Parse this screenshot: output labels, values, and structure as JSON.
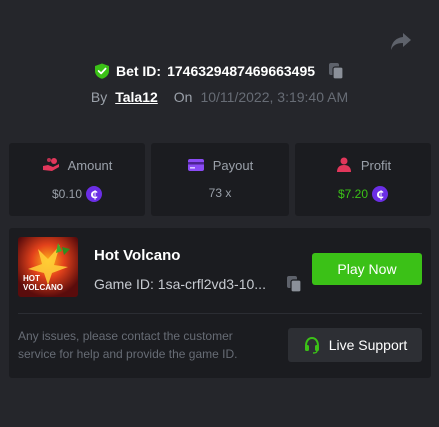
{
  "header": {
    "bet_label": "Bet ID:",
    "bet_id": "1746329487469663495",
    "by_label": "By",
    "username": "Tala12",
    "on_label": "On",
    "datetime": "10/11/2022, 3:19:40 AM"
  },
  "stats": {
    "amount": {
      "label": "Amount",
      "value": "$0.10",
      "icon": "coins-hand-icon"
    },
    "payout": {
      "label": "Payout",
      "value": "73 x",
      "icon": "payout-card-icon"
    },
    "profit": {
      "label": "Profit",
      "value": "$7.20",
      "icon": "profit-person-icon"
    }
  },
  "coin_symbol": "₵",
  "game": {
    "title": "Hot Volcano",
    "id_label": "Game ID:",
    "id_value": "1sa-crfl2vd3-10...",
    "thumb_text_1": "HOT",
    "thumb_text_2": "VOLCANO",
    "play_label": "Play Now"
  },
  "support": {
    "message": "Any issues, please contact the customer service for help and provide the game ID.",
    "button_label": "Live Support"
  },
  "colors": {
    "background": "#25262b",
    "card": "#1b1c20",
    "accent_green": "#3bc117",
    "coin_purple": "#6b2ee6",
    "amount_icon": "#e2375b",
    "payout_icon": "#8a4bf5",
    "profit_icon": "#e2375b"
  }
}
